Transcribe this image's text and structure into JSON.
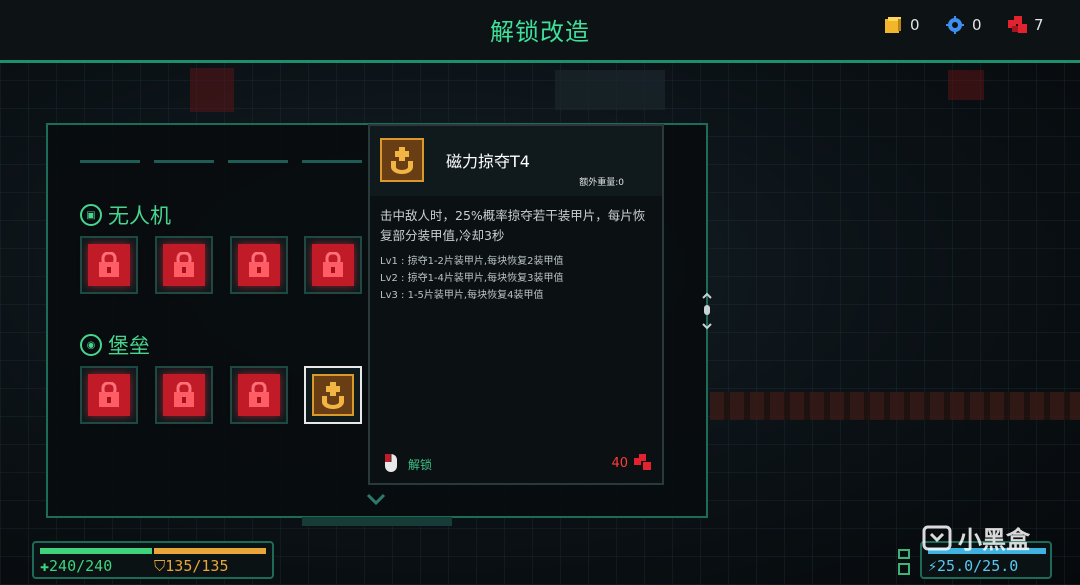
{
  "header": {
    "title": "解锁改造",
    "resources": [
      {
        "icon": "gold-block-icon",
        "value": "0",
        "color": "#f1b62a"
      },
      {
        "icon": "blue-gear-icon",
        "value": "0",
        "color": "#3d8ef0"
      },
      {
        "icon": "red-parts-icon",
        "value": "7",
        "color": "#e2222f"
      }
    ]
  },
  "sections": {
    "drone": {
      "label": "无人机",
      "icon": "drone-icon"
    },
    "fortress": {
      "label": "堡垒",
      "icon": "fortress-icon"
    }
  },
  "slots": {
    "locked_icon": "lock-icon",
    "selected_icon": "magnet-loot-icon"
  },
  "tooltip": {
    "name": "磁力掠夺T4",
    "extra_weight": "额外重量:0",
    "description": "击中敌人时，25%概率掠夺若干装甲片，每片恢复部分装甲值,冷却3秒",
    "levels": [
      "Lv1 : 掠夺1-2片装甲片,每块恢复2装甲值",
      "Lv2 : 掠夺1-4片装甲片,每块恢复3装甲值",
      "Lv3 : 1-5片装甲片,每块恢复4装甲值"
    ],
    "action_label": "解锁",
    "cost": "40"
  },
  "hud": {
    "hp": "240/240",
    "shield": "135/135",
    "energy": "25.0/25.0",
    "hp_fraction": 1.0,
    "shield_fraction": 1.0,
    "energy_fraction": 1.0,
    "colors": {
      "hp": "#3fd37d",
      "shield": "#e8a63a",
      "energy": "#3fb2e0"
    }
  },
  "watermark": {
    "text": "小黑盒"
  }
}
